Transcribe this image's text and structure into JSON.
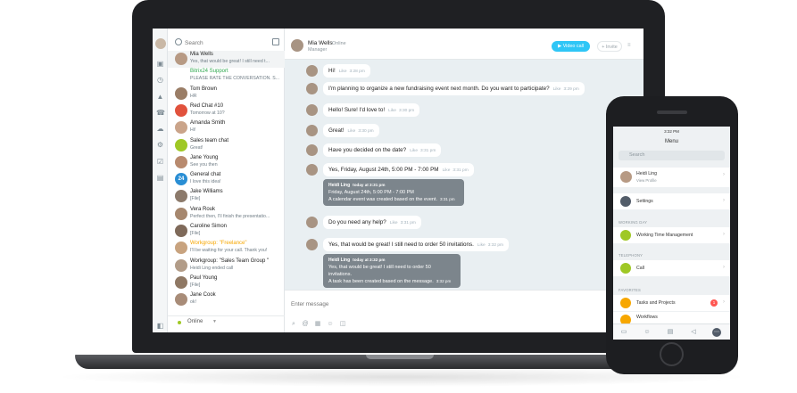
{
  "chat_list": {
    "search_placeholder": "Search",
    "status": "Online",
    "items": [
      {
        "name": "Mia Wells",
        "snippet": "Yes, that would be great! I still need t...",
        "active": true,
        "name_color": "#222222",
        "avatar_color": "#b79a84"
      },
      {
        "name": "Bitrix24 Support",
        "snippet": "PLEASE RATE THE CONVERSATION. S...",
        "name_color": "#2fa84f",
        "avatar_color": ""
      },
      {
        "name": "Tom Brown",
        "snippet": "HR",
        "name_color": "#222222",
        "avatar_color": "#9a7d66"
      },
      {
        "name": "Red Chat #10",
        "snippet": "Tomorrow at 10?",
        "name_color": "#222222",
        "avatar_color": "#e1523d"
      },
      {
        "name": "Amanda Smith",
        "snippet": "Hi!",
        "name_color": "#222222",
        "avatar_color": "#caa48a"
      },
      {
        "name": "Sales team chat",
        "snippet": "Great!",
        "name_color": "#222222",
        "avatar_color": "#9fc825"
      },
      {
        "name": "Jane Young",
        "snippet": "See you then",
        "name_color": "#222222",
        "avatar_color": "#b88a6e"
      },
      {
        "name": "General chat",
        "snippet": "I love this idea!",
        "name_color": "#222222",
        "avatar_color": "#2a8ed4",
        "avatar_text": "24"
      },
      {
        "name": "Jake Williams",
        "snippet": "[File]",
        "name_color": "#222222",
        "avatar_color": "#8c7a6b"
      },
      {
        "name": "Vera Rouk",
        "snippet": "Perfect then, I'll finish the presentatio...",
        "name_color": "#222222",
        "avatar_color": "#a6876e"
      },
      {
        "name": "Caroline Simon",
        "snippet": "[File]",
        "name_color": "#222222",
        "avatar_color": "#7f6a5a"
      },
      {
        "name": "Workgroup: \"Freelance\"",
        "snippet": "I'll be waiting for your call. Thank you!",
        "name_color": "#f7a700",
        "avatar_color": "#c8a37f"
      },
      {
        "name": "Workgroup: \"Sales Team Group \"",
        "snippet": "Heidi Ling ended call",
        "name_color": "#222222",
        "avatar_color": "#b29c88"
      },
      {
        "name": "Paul Young",
        "snippet": "[File]",
        "name_color": "#222222",
        "avatar_color": "#8f7864"
      },
      {
        "name": "Jane Cook",
        "snippet": "ok!",
        "name_color": "#222222",
        "avatar_color": "#a88c78"
      }
    ]
  },
  "chat": {
    "contact_name": "Mia Wells",
    "contact_status": "Online",
    "contact_role": "Manager",
    "video_call_label": "Video call",
    "invite_label": "Invite",
    "composer_placeholder": "Enter message",
    "like_label": "Like",
    "messages": [
      {
        "text": "Hi!",
        "time": "3:28 pm"
      },
      {
        "text": "I'm planning to organize a new fundraising event next month. Do you want to participate?",
        "time": "3:29 pm"
      },
      {
        "text": "Hello! Sure! I'd love to!",
        "time": "3:30 pm"
      },
      {
        "text": "Great!",
        "time": "3:30 pm"
      },
      {
        "text": "Have you decided on the date?",
        "time": "3:31 pm"
      },
      {
        "text": "Yes, Friday, August 24th, 5:00 PM - 7:00 PM",
        "time": "3:31 pm"
      },
      {
        "text": "Do you need any help?",
        "time": "3:31 pm"
      },
      {
        "text": "Yes, that would be great! I still need to order 50 invitations.",
        "time": "3:32 pm"
      }
    ],
    "system_messages": [
      {
        "head": "Heidi Ling",
        "head_time": "today at 3:31 pm",
        "line1": "Friday, August 24th, 5:00 PM - 7:00 PM",
        "line2": "A calendar event was created based on the event.",
        "time": "3:31 pm"
      },
      {
        "head": "Heidi Ling",
        "head_time": "today at 3:32 pm",
        "line1": "Yes, that would be great! I still need to order 50",
        "line2": "invitations.",
        "line3": "A task has been created based on the message.",
        "time": "3:32 pm"
      }
    ]
  },
  "phone": {
    "status_time": "3:32 PM",
    "title": "Menu",
    "search_placeholder": "Search",
    "profile_name": "Heidi Ling",
    "profile_sub": "View Profile",
    "settings_label": "Settings",
    "section_working_day": "WORKING DAY",
    "working_time_label": "Working Time Management",
    "section_telephony": "TELEPHONY",
    "call_label": "Call",
    "section_favorites": "FAVORITES",
    "tasks_label": "Tasks and Projects",
    "tasks_badge": "1",
    "workflows_label": "Workflows"
  },
  "colors": {
    "accent": "#2fc6f6",
    "online": "#9fc825"
  }
}
